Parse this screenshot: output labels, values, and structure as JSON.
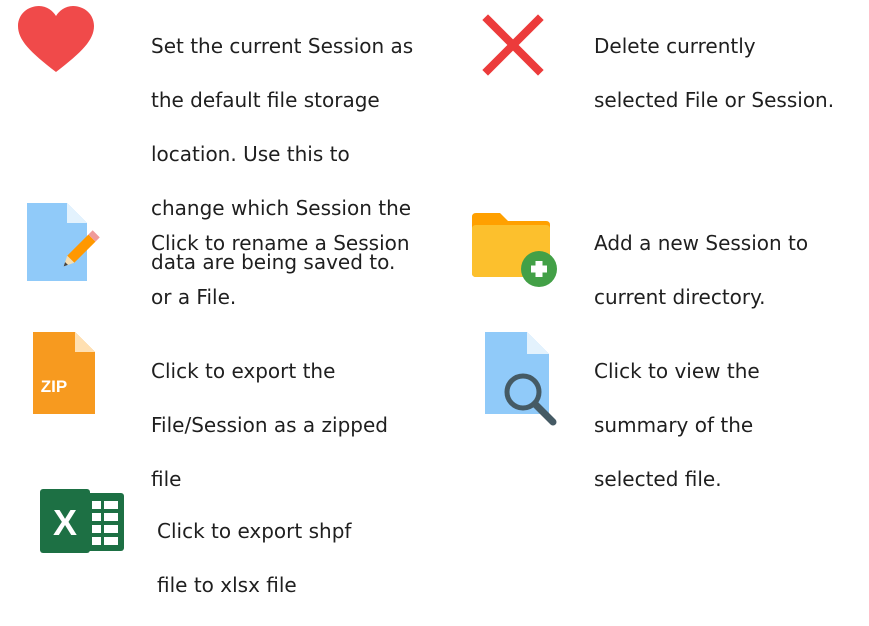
{
  "items": [
    {
      "icon": "heart-icon",
      "lines": [
        "Set the current Session as",
        "the default file storage",
        "location.  Use this to",
        "change which Session the",
        "data are being saved to."
      ]
    },
    {
      "icon": "delete-x-icon",
      "lines": [
        "Delete currently",
        "selected File or Session."
      ]
    },
    {
      "icon": "rename-file-icon",
      "lines": [
        "Click to rename a Session",
        "or a File."
      ]
    },
    {
      "icon": "add-folder-icon",
      "lines": [
        "Add a new Session to",
        "current directory."
      ]
    },
    {
      "icon": "zip-file-icon",
      "zip_label": "ZIP",
      "lines": [
        "Click to export the",
        "File/Session as a zipped",
        "file"
      ]
    },
    {
      "icon": "view-summary-icon",
      "lines": [
        "Click to view the",
        "summary of the",
        "selected file."
      ]
    },
    {
      "icon": "excel-icon",
      "excel_letter": "X",
      "lines": [
        "Click  to  export  shpf",
        "file to xlsx file"
      ]
    }
  ],
  "colors": {
    "heart": "#f04a4a",
    "delete_x": "#ec3b3b",
    "file_blue": "#90caf9",
    "zip_orange": "#f79a1f",
    "folder_yellow": "#fcc02d",
    "plus_green": "#43a047",
    "excel_green": "#1d7044"
  }
}
